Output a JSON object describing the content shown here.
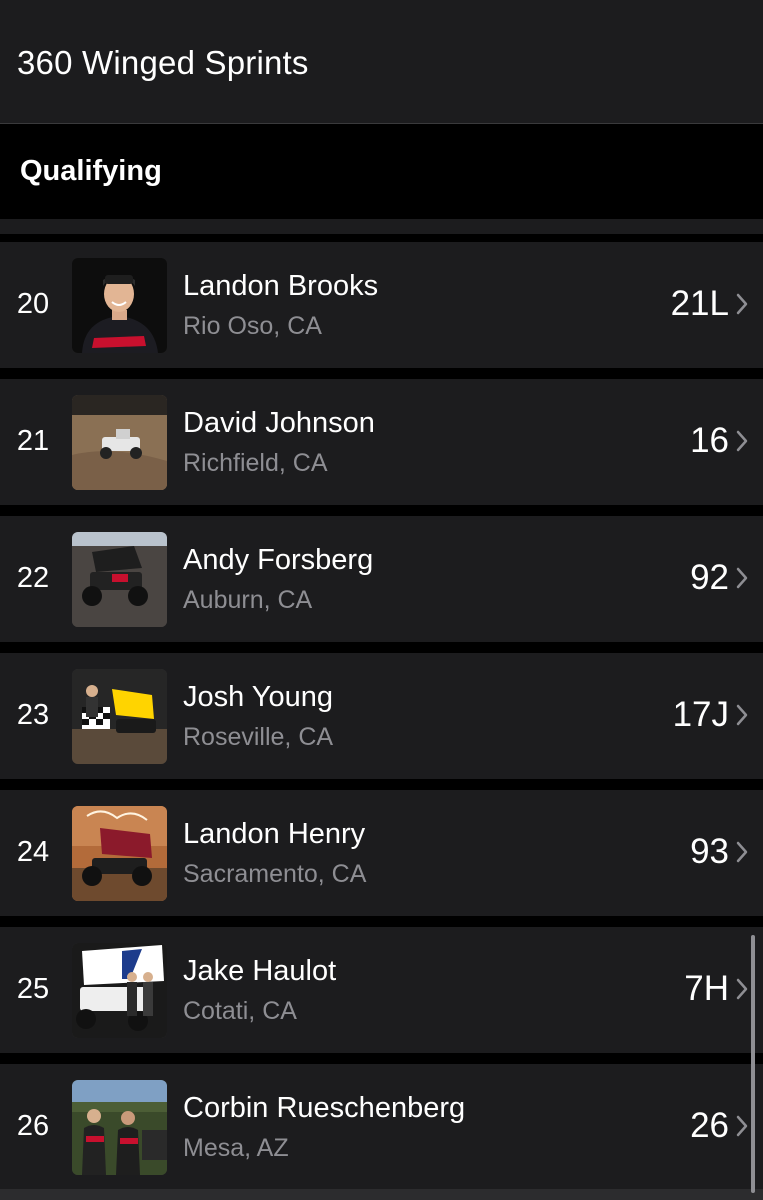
{
  "header": {
    "title": "360 Winged Sprints"
  },
  "section": {
    "title": "Qualifying"
  },
  "icons": {
    "row_chevron": "chevron-right-icon"
  },
  "colors": {
    "background": "#000000",
    "row_background": "#1c1c1e",
    "primary_text": "#ffffff",
    "secondary_text": "#8e8e93"
  },
  "rows": [
    {
      "position": "20",
      "name": "Landon Brooks",
      "location": "Rio Oso, CA",
      "car_number": "21L"
    },
    {
      "position": "21",
      "name": "David Johnson",
      "location": "Richfield, CA",
      "car_number": "16"
    },
    {
      "position": "22",
      "name": "Andy Forsberg",
      "location": "Auburn, CA",
      "car_number": "92"
    },
    {
      "position": "23",
      "name": "Josh Young",
      "location": "Roseville, CA",
      "car_number": "17J"
    },
    {
      "position": "24",
      "name": "Landon Henry",
      "location": "Sacramento, CA",
      "car_number": "93"
    },
    {
      "position": "25",
      "name": "Jake Haulot",
      "location": "Cotati, CA",
      "car_number": "7H"
    },
    {
      "position": "26",
      "name": "Corbin Rueschenberg",
      "location": "Mesa, AZ",
      "car_number": "26"
    }
  ]
}
